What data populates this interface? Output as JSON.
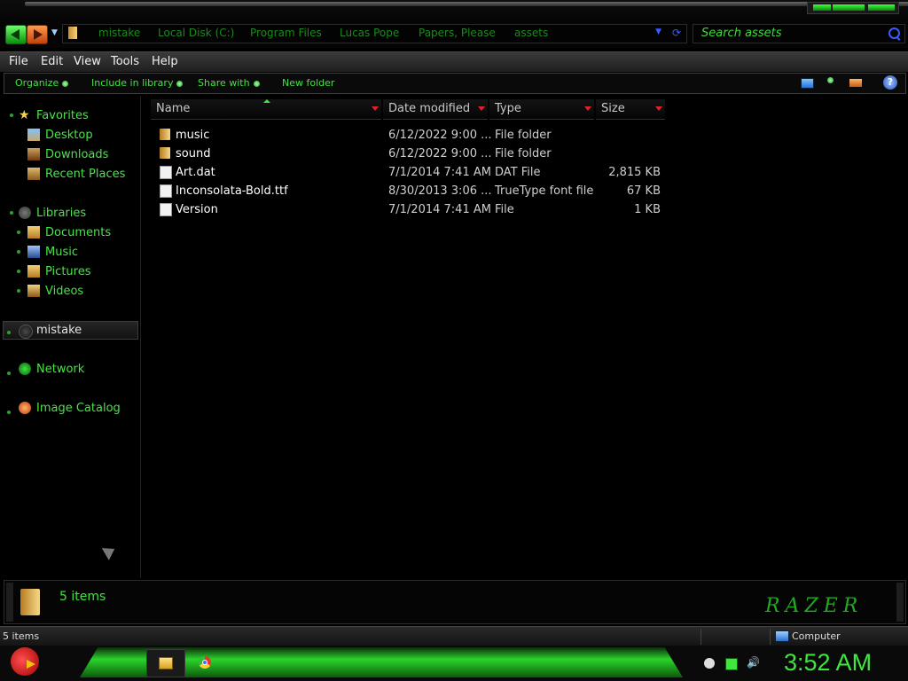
{
  "window": {
    "breadcrumbs": [
      "mistake",
      "Local Disk (C:)",
      "Program Files",
      "Lucas Pope",
      "Papers, Please",
      "assets"
    ],
    "search_placeholder": "Search assets"
  },
  "menu": [
    "File",
    "Edit",
    "View",
    "Tools",
    "Help"
  ],
  "commands": [
    "Organize",
    "Include in library",
    "Share with",
    "New folder"
  ],
  "nav": {
    "favorites": {
      "label": "Favorites",
      "items": [
        "Desktop",
        "Downloads",
        "Recent Places"
      ]
    },
    "libraries": {
      "label": "Libraries",
      "items": [
        "Documents",
        "Music",
        "Pictures",
        "Videos"
      ]
    },
    "computer": "mistake",
    "network": "Network",
    "image_catalog": "Image Catalog"
  },
  "columns": [
    "Name",
    "Date modified",
    "Type",
    "Size"
  ],
  "files": [
    {
      "name": "music",
      "date": "6/12/2022 9:00 ...",
      "type": "File folder",
      "size": "",
      "icon": "folder"
    },
    {
      "name": "sound",
      "date": "6/12/2022 9:00 ...",
      "type": "File folder",
      "size": "",
      "icon": "folder"
    },
    {
      "name": "Art.dat",
      "date": "7/1/2014 7:41 AM",
      "type": "DAT File",
      "size": "2,815 KB",
      "icon": "file"
    },
    {
      "name": "Inconsolata-Bold.ttf",
      "date": "8/30/2013 3:06 ...",
      "type": "TrueType font file",
      "size": "67 KB",
      "icon": "font-file"
    },
    {
      "name": "Version",
      "date": "7/1/2014 7:41 AM",
      "type": "File",
      "size": "1 KB",
      "icon": "file"
    }
  ],
  "details": {
    "count": "5 items",
    "brand": "RAZER"
  },
  "status": {
    "left": "5 items",
    "right": "Computer"
  },
  "taskbar": {
    "clock": "3:52 AM"
  },
  "colors": {
    "accent_green": "#3ee63e",
    "background": "#000000"
  }
}
